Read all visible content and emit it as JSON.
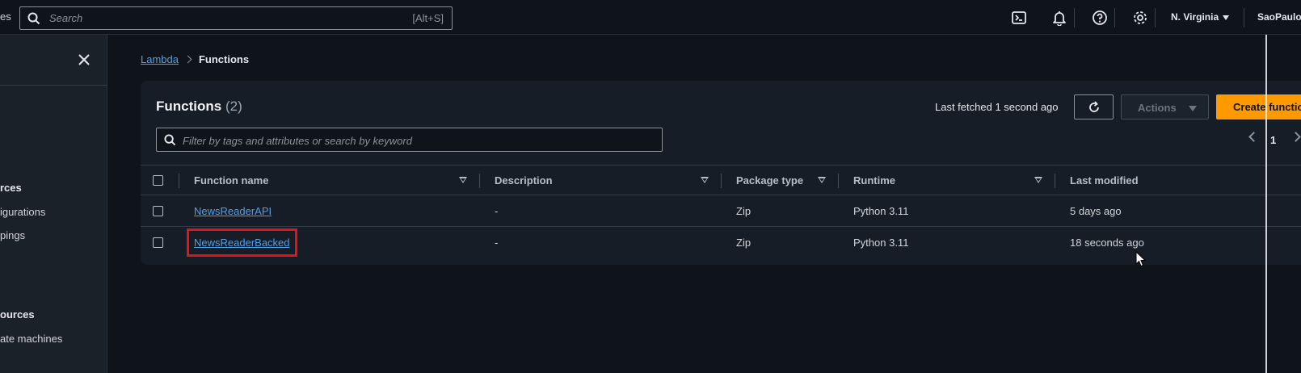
{
  "topbar": {
    "cut_left_text": "es",
    "search_placeholder": "Search",
    "search_shortcut": "[Alt+S]",
    "region": "N. Virginia",
    "account": "SaoPaulo-"
  },
  "sidebar": {
    "items": [
      {
        "label": "rces",
        "kind": "head"
      },
      {
        "label": "igurations",
        "kind": "item"
      },
      {
        "label": "pings",
        "kind": "item"
      },
      {
        "label": "ources",
        "kind": "head"
      },
      {
        "label": "ate machines",
        "kind": "item"
      }
    ]
  },
  "breadcrumb": {
    "parent": "Lambda",
    "current": "Functions"
  },
  "panel": {
    "title": "Functions",
    "count": "(2)",
    "last_fetched": "Last fetched 1 second ago",
    "actions_label": "Actions",
    "create_label": "Create function",
    "filter_placeholder": "Filter by tags and attributes or search by keyword",
    "page": "1"
  },
  "table": {
    "headers": [
      "Function name",
      "Description",
      "Package type",
      "Runtime",
      "Last modified"
    ],
    "rows": [
      {
        "name": "NewsReaderAPI",
        "description": "-",
        "package_type": "Zip",
        "runtime": "Python 3.11",
        "last_modified": "5 days ago"
      },
      {
        "name": "NewsReaderBacked",
        "description": "-",
        "package_type": "Zip",
        "runtime": "Python 3.11",
        "last_modified": "18 seconds ago"
      }
    ]
  },
  "colors": {
    "accent_orange": "#ff9900",
    "link_blue": "#539fe5",
    "highlight_red": "#e0151c",
    "background": "#0f141a",
    "panel": "#161d26"
  }
}
